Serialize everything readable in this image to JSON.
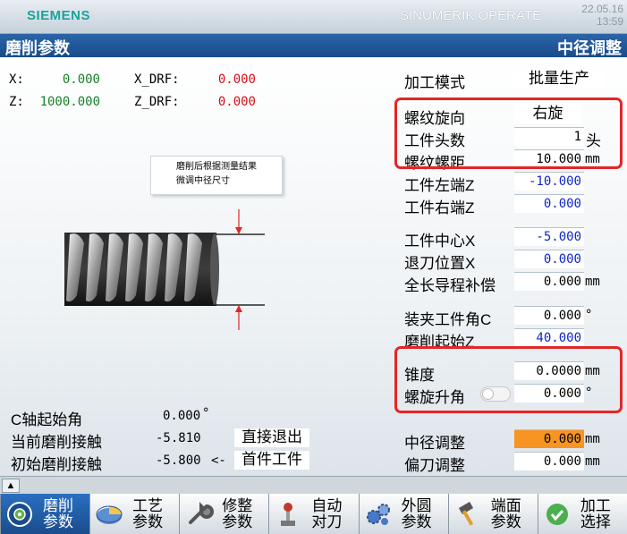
{
  "header": {
    "brand": "SIEMENS",
    "product": "SINUMERIK OPERATE",
    "date": "22.05.16",
    "time": "13:59"
  },
  "title": {
    "left": "磨削参数",
    "right": "中径调整"
  },
  "positions": {
    "x_label": "X:",
    "x_value": "0.000",
    "z_label": "Z:",
    "z_value": "1000.000",
    "xdrf_label": "X_DRF:",
    "xdrf_value": "0.000",
    "zdrf_label": "Z_DRF:",
    "zdrf_value": "0.000"
  },
  "note": {
    "line1": "磨削后根据测量结果",
    "line2": "微调中径尺寸"
  },
  "params": {
    "mode_label": "加工模式",
    "mode_value": "批量生产",
    "direction_label": "螺纹旋向",
    "direction_value": "右旋",
    "starts_label": "工件头数",
    "starts_value": "1",
    "starts_unit": "头",
    "pitch_label": "螺纹螺距",
    "pitch_value": "10.000",
    "pitch_unit": "mm",
    "left_end_label": "工件左端Z",
    "left_end_value": "-10.000",
    "right_end_label": "工件右端Z",
    "right_end_value": "0.000",
    "center_label": "工件中心X",
    "center_value": "-5.000",
    "retract_label": "退刀位置X",
    "retract_value": "0.000",
    "lead_comp_label": "全长导程补偿",
    "lead_comp_value": "0.000",
    "lead_comp_unit": "mm",
    "clamp_angle_label": "装夹工件角C",
    "clamp_angle_value": "0.000",
    "clamp_angle_unit": "°",
    "grind_start_label": "磨削起始Z",
    "grind_start_value": "40.000",
    "taper_label": "锥度",
    "taper_value": "0.0000",
    "taper_unit": "mm",
    "helix_label": "螺旋升角",
    "helix_value": "0.000",
    "helix_unit": "°",
    "pitch_adjust_label": "中径调整",
    "pitch_adjust_value": "0.000",
    "pitch_adjust_unit": "mm",
    "offset_label": "偏刀调整",
    "offset_value": "0.000",
    "offset_unit": "mm"
  },
  "bottom_info": {
    "c_start_label": "C轴起始角",
    "c_start_value": "0.000",
    "c_start_unit": "°",
    "cur_contact_label": "当前磨削接触",
    "cur_contact_value": "-5.810",
    "cur_contact_action": "直接退出",
    "init_contact_label": "初始磨削接触",
    "init_contact_value": "-5.800",
    "init_contact_arrow": "<-",
    "init_contact_action": "首件工件"
  },
  "softkeys": [
    {
      "line1": "磨削",
      "line2": "参数",
      "icon": "grind-wheel-icon"
    },
    {
      "line1": "工艺",
      "line2": "参数",
      "icon": "pie-chart-icon"
    },
    {
      "line1": "修整",
      "line2": "参数",
      "icon": "wrench-icon"
    },
    {
      "line1": "自动",
      "line2": "对刀",
      "icon": "joystick-icon"
    },
    {
      "line1": "外圆",
      "line2": "参数",
      "icon": "gears-icon"
    },
    {
      "line1": "端面",
      "line2": "参数",
      "icon": "hammer-icon"
    },
    {
      "line1": "加工",
      "line2": "选择",
      "icon": "check-icon"
    }
  ],
  "colors": {
    "accent_blue": "#1a4c8c",
    "highlight_orange": "#f79422",
    "alert_red": "#e32626"
  }
}
